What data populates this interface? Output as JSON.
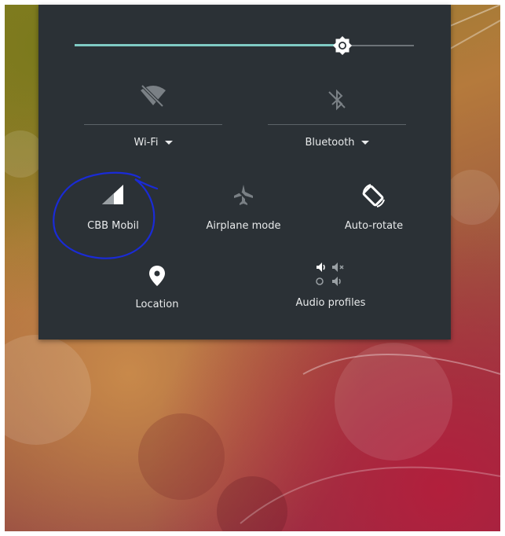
{
  "quick_settings": {
    "brightness_level": 0.79,
    "wifi": {
      "label": "Wi-Fi",
      "icon": "wifi-off-icon"
    },
    "bluetooth": {
      "label": "Bluetooth",
      "icon": "bluetooth-off-icon"
    },
    "tiles": [
      {
        "label": "CBB Mobil",
        "icon": "cell-signal-icon"
      },
      {
        "label": "Airplane mode",
        "icon": "airplane-icon"
      },
      {
        "label": "Auto-rotate",
        "icon": "auto-rotate-icon"
      },
      {
        "label": "Location",
        "icon": "location-pin-icon"
      },
      {
        "label": "Audio profiles",
        "icon": "audio-profiles-icon"
      }
    ]
  },
  "colors": {
    "panel": "#2b3136",
    "accent": "#80cbc4",
    "annotation": "#1a2bd6"
  }
}
